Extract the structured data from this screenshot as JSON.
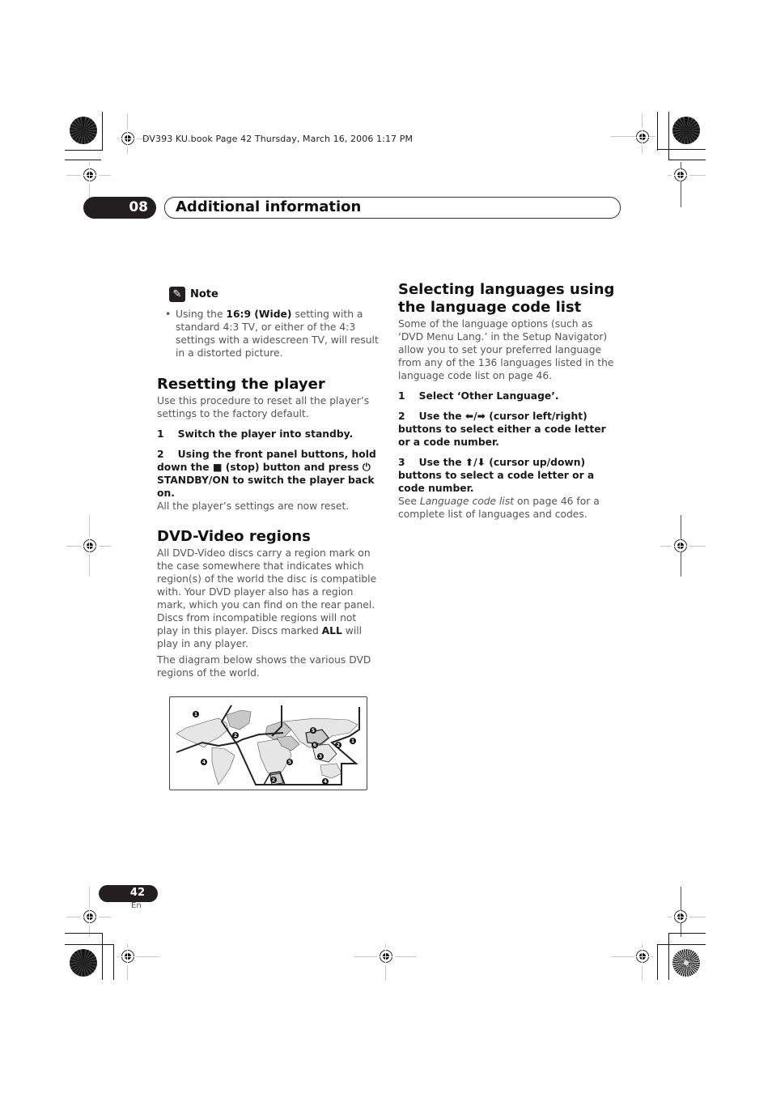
{
  "print_slug": "DV393 KU.book  Page 42  Thursday, March 16, 2006  1:17 PM",
  "chapter": {
    "number": "08",
    "title": "Additional information"
  },
  "note": {
    "icon": "pencil-icon",
    "label": "Note",
    "bullet": "•",
    "items": [
      {
        "pre": "Using the ",
        "bold": "16:9 (Wide)",
        "post": " setting with a standard 4:3 TV, or either of the 4:3 settings with a widescreen TV, will result in a distorted picture."
      }
    ]
  },
  "resetting": {
    "heading": "Resetting the player",
    "intro": "Use this procedure to reset all the player’s settings to the factory default.",
    "step1": "1    Switch the player into standby.",
    "step2": {
      "a": "2    Using the front panel buttons, hold down the ",
      "stop_icon": "■",
      "b": " (stop) button and press ",
      "power_icon": "⏻",
      "c": " STANDBY/ON to switch the player back on."
    },
    "result": "All the player’s settings are now reset."
  },
  "regions": {
    "heading": "DVD-Video regions",
    "para1_pre": "All DVD-Video discs carry a region mark on the case somewhere that indicates which region(s) of the world the disc is compatible with. Your DVD player also has a region mark, which you can find on the rear panel. Discs from incompatible regions will not play in this player. Discs marked ",
    "para1_bold": "ALL",
    "para1_post": " will play in any player.",
    "para2": "The diagram below shows the various DVD regions of the world.",
    "map_labels": [
      "1",
      "2",
      "2",
      "4",
      "5",
      "5",
      "6",
      "3",
      "2",
      "1",
      "4",
      "2",
      "4"
    ]
  },
  "languages": {
    "heading": "Selecting languages using the language code list",
    "intro": "Some of the language options (such as ‘DVD Menu Lang.’ in the Setup Navigator) allow you to set your preferred language from any of the 136 languages listed in the language code list on page 46.",
    "step1": "1    Select ‘Other Language’.",
    "step2": {
      "a": "2    Use the ",
      "arrows": "⬅/➡",
      "b": " (cursor left/right) buttons to select either a code letter or a code number."
    },
    "step3": {
      "a": "3    Use the ",
      "arrows": "⬆/⬇",
      "b": " (cursor up/down) buttons to select a code letter or a code number."
    },
    "see_pre": "See ",
    "see_italic": "Language code list",
    "see_post": " on page 46 for a complete list of languages and codes."
  },
  "footer": {
    "page_number": "42",
    "language": "En"
  }
}
